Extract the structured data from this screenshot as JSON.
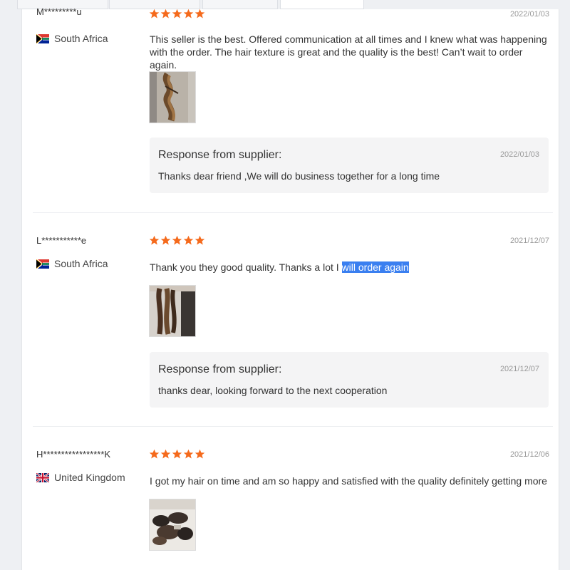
{
  "colors": {
    "star": "#f56a1c",
    "highlight": "#3a7ff0",
    "response_bg": "#f4f4f5"
  },
  "reviews": [
    {
      "reviewer": "M*********u",
      "country": "South Africa",
      "flag_icon": "south-africa-flag-icon",
      "rating": 5,
      "date": "2022/01/03",
      "text": "This seller is the best. Offered communication at all times and I knew what was happening with the order. The hair texture is great and the quality is the best! Can’t wait to order again.",
      "response": {
        "title": "Response from supplier:",
        "date": "2022/01/03",
        "text": "Thanks dear friend ,We will do business together for a long time"
      }
    },
    {
      "reviewer": "L***********e",
      "country": "South Africa",
      "flag_icon": "south-africa-flag-icon",
      "rating": 5,
      "date": "2021/12/07",
      "text": "Thank you they good quality. Thanks a lot I",
      "text_highlighted": "will order again",
      "response": {
        "title": "Response from supplier:",
        "date": "2021/12/07",
        "text": "thanks dear, looking forward to the next cooperation"
      }
    },
    {
      "reviewer": "H*****************K",
      "country": "United Kingdom",
      "flag_icon": "united-kingdom-flag-icon",
      "rating": 5,
      "date": "2021/12/06",
      "text": "I got my hair on time and am so happy and satisfied with the quality definitely getting more"
    }
  ]
}
